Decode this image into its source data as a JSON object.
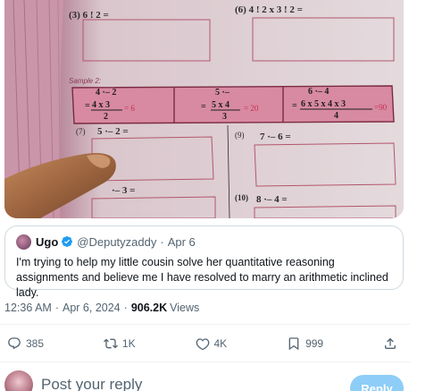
{
  "photo": {
    "problems": {
      "p3": "(3)  6  !  2  =",
      "p6": "(6)      4  !  2 x 3  !  2  =",
      "p7_num": "(7)",
      "p7_expr": "5    ·– 2 =",
      "p9_num": "(9)",
      "p9_expr": "7   ·–  6  =",
      "p8_expr": "·–  3 =",
      "p10_num": "(10)",
      "p10_expr": "8     ·–   4  ="
    },
    "sample": {
      "label": "Sample 2:",
      "c1_top": "4 ·– 2",
      "c1_eq": "=",
      "c1_num": "4 x 3",
      "c1_den": "2",
      "c1_res": "= 6",
      "c2_top": "5 ·–",
      "c2_eq": "=",
      "c2_num": "5 x 4",
      "c2_den": "3",
      "c2_res": "= 20",
      "c3_top": "6 ·– 4",
      "c3_eq": "=",
      "c3_num": "6 x 5 x 4 x 3",
      "c3_den": "4",
      "c3_res": "=90"
    }
  },
  "quote": {
    "name": "Ugo",
    "handle": "@Deputyzaddy",
    "separator": "·",
    "date": "Apr 6",
    "text": "I'm trying to help my little cousin solve her quantitative reasoning assignments and believe me I have resolved to marry an arithmetic inclined lady."
  },
  "meta": {
    "time": "12:36 AM",
    "dot1": "·",
    "date": "Apr 6, 2024",
    "dot2": "·",
    "views_count": "906.2K",
    "views_label": "Views"
  },
  "actions": {
    "replies": "385",
    "reposts": "1K",
    "likes": "4K",
    "bookmarks": "999"
  },
  "composer": {
    "placeholder": "Post your reply",
    "button": "Reply"
  },
  "icons": {
    "reply": "comment-icon",
    "repost": "repost-icon",
    "like": "heart-icon",
    "bookmark": "bookmark-icon",
    "share": "share-icon",
    "verified": "verified-badge-icon"
  },
  "colors": {
    "accent": "#1d9bf0",
    "reply_button": "#8ecdf7",
    "secondary_text": "#536471",
    "border": "#cfd9de"
  }
}
